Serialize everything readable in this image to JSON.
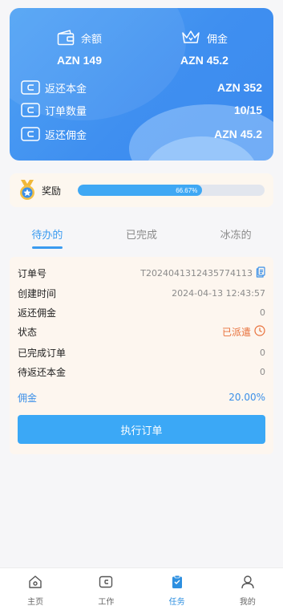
{
  "summary": {
    "balance_label": "余额",
    "balance_value": "AZN 149",
    "commission_label": "佣金",
    "commission_value": "AZN 45.2",
    "rows": [
      {
        "label": "返还本金",
        "value": "AZN 352",
        "icon": "wallet-icon"
      },
      {
        "label": "订单数量",
        "value": "10/15",
        "icon": "wallet-icon"
      },
      {
        "label": "返还佣金",
        "value": "AZN 45.2",
        "icon": "wallet-icon"
      }
    ]
  },
  "reward": {
    "label": "奖励",
    "progress_text": "66.67%",
    "progress_fraction": 0.6667,
    "icon": "medal-icon"
  },
  "tabs": [
    "待办的",
    "已完成",
    "冰冻的"
  ],
  "active_tab": 0,
  "order": {
    "order_no_label": "订单号",
    "order_no": "T2024041312435774113",
    "created_label": "创建时间",
    "created_value": "2024-04-13 12:43:57",
    "return_commission_label": "返还佣金",
    "return_commission_value": "0",
    "status_label": "状态",
    "status_value": "已派遣",
    "completed_label": "已完成订单",
    "completed_value": "0",
    "pending_principal_label": "待返还本金",
    "pending_principal_value": "0",
    "commission_label": "佣金",
    "commission_value": "20.00%",
    "execute_button": "执行订单"
  },
  "colors": {
    "primary": "#3ba8f6",
    "card_blue": "#3f8ff0",
    "status_orange": "#e8703a"
  },
  "nav": [
    {
      "label": "主页",
      "icon": "home-icon"
    },
    {
      "label": "工作",
      "icon": "wallet-icon"
    },
    {
      "label": "任务",
      "icon": "clipboard-icon",
      "active": true
    },
    {
      "label": "我的",
      "icon": "user-icon"
    }
  ]
}
